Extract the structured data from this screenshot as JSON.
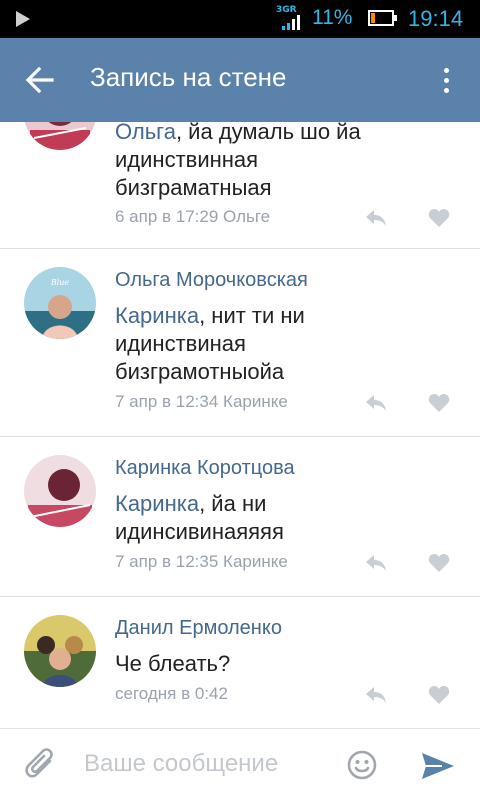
{
  "status_bar": {
    "network": "3G",
    "network_badge": "R",
    "battery_percent": "11%",
    "battery_level": 0.11,
    "time": "19:14",
    "notification_icon": "play-icon"
  },
  "header": {
    "title": "Запись на стене",
    "back_icon": "back-arrow-icon",
    "menu_icon": "overflow-menu-icon"
  },
  "comments": [
    {
      "author": "",
      "mention": "Ольга",
      "text_after_mention": ", йа думаль шо йа идинствинная бизграматныая",
      "meta": "6 апр в 17:29 Ольге"
    },
    {
      "author": "Ольга Морочковская",
      "mention": "Каринка",
      "text_after_mention": ", нит ти ни идинствиная бизграмотныойа",
      "meta": "7 апр в 12:34 Каринке"
    },
    {
      "author": "Каринка Коротцова",
      "mention": "Каринка",
      "text_after_mention": ", йа ни идинсивинаяяяя",
      "meta": "7 апр в 12:35 Каринке"
    },
    {
      "author": "Данил Ермоленко",
      "mention": "",
      "text_after_mention": "Че блеать?",
      "meta": "сегодня в 0:42"
    }
  ],
  "composer": {
    "placeholder": "Ваше сообщение",
    "value": ""
  },
  "colors": {
    "header": "#5b82aa",
    "link": "#45688e",
    "meta": "#9aa3ad",
    "status_accent": "#35b5e5"
  }
}
